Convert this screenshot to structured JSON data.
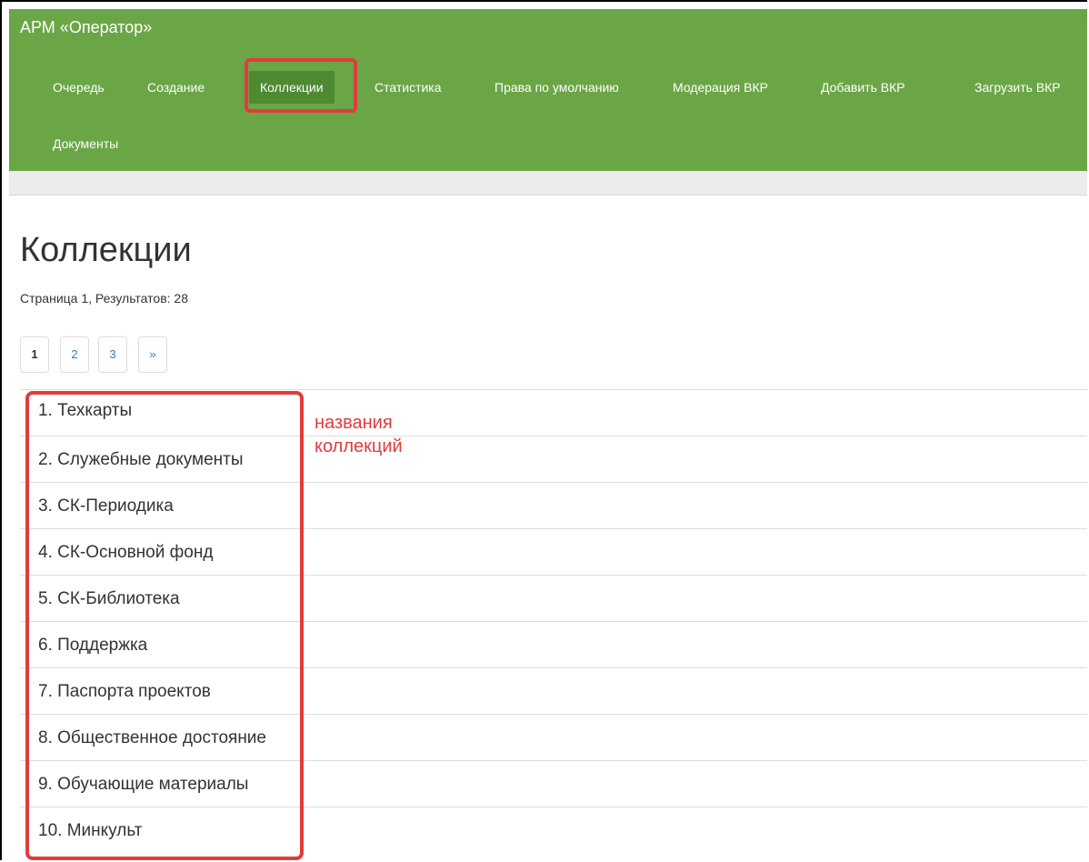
{
  "app": {
    "title": "АРМ «Оператор»"
  },
  "nav": {
    "items": [
      {
        "label": "Очередь"
      },
      {
        "label": "Создание"
      },
      {
        "label": "Коллекции"
      },
      {
        "label": "Статистика"
      },
      {
        "label": "Права по умолчанию"
      },
      {
        "label": "Модерация ВКР"
      },
      {
        "label": "Добавить ВКР"
      },
      {
        "label": "Загрузить ВКР"
      },
      {
        "label": "Документы"
      }
    ],
    "active": "Коллекции"
  },
  "page": {
    "title": "Коллекции",
    "results": "Страница 1, Результатов: 28"
  },
  "pagination": {
    "pages": [
      "1",
      "2",
      "3",
      "»"
    ],
    "current": "1"
  },
  "collections": [
    "1. Техкарты",
    "2. Служебные документы",
    "3. СК-Периодика",
    "4. СК-Основной фонд",
    "5. СК-Библиотека",
    "6. Поддержка",
    "7. Паспорта проектов",
    "8. Общественное достояние",
    "9. Обучающие материалы",
    "10. Минкульт"
  ],
  "annotation": {
    "line1": "названия",
    "line2": "коллекций"
  },
  "colors": {
    "navbar": "#6aa646",
    "active_nav": "#4d8a31",
    "highlight": "#e23b3b",
    "link": "#337ab7"
  }
}
